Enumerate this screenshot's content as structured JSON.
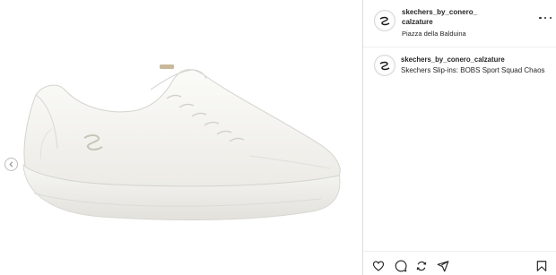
{
  "post": {
    "account": {
      "username": "skechers_by_conero_\ncalzature",
      "location": "Piazza della Balduina"
    },
    "caption": {
      "username": "skechers_by_conero_calzature",
      "text": "Skechers Slip-ins: BOBS Sport Squad Chaos"
    },
    "media": {
      "image_alt": "white slip-on sneaker"
    },
    "icons": {
      "prev": "chevron-left-icon",
      "more": "more-options-icon",
      "like": "heart-icon",
      "comment": "comment-icon",
      "share": "send-icon",
      "save": "bookmark-icon"
    },
    "colors": {
      "text": "#262626",
      "border": "#dbdbdb",
      "background": "#ffffff"
    }
  }
}
